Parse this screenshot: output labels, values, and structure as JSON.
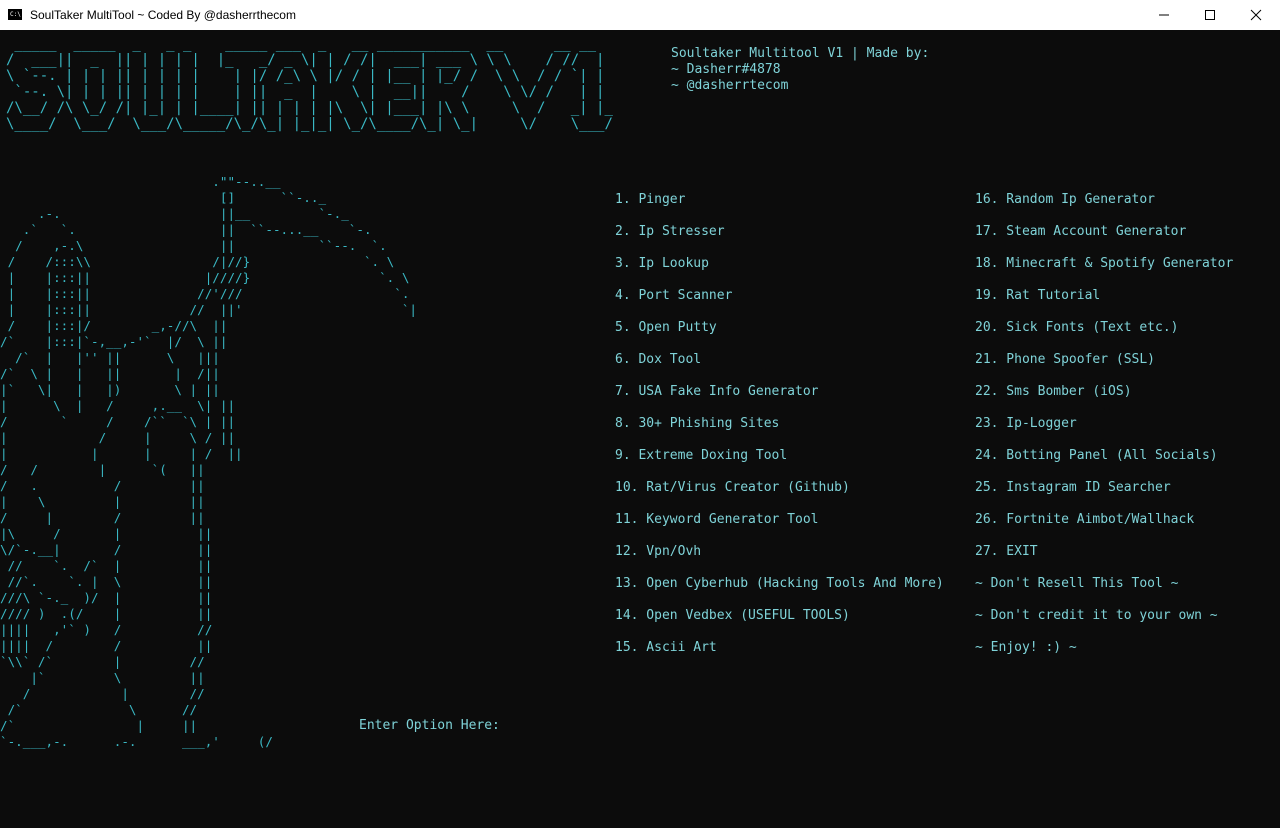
{
  "window": {
    "title": "SoulTaker MultiTool ~ Coded By @dasherrthecom",
    "icon": "cmd-icon",
    "controls": [
      "minimize-icon",
      "maximize-icon",
      "close-icon"
    ]
  },
  "console": {
    "banner": " _____  _____  _   _ _    _____ ___  _   __ ___________  __      __ __\n/  ___||  _  || | | | |  |_   _/ _ \\| | / /|  ___| ___ \\ \\ \\    / //  |\n\\ `--. | | | || | | | |    | |/ /_\\ \\ |/ / | |__ | |_/ /  \\ \\  / / `| |\n `--. \\| | | || | | | |    | ||  _  |    \\ |  __||    /    \\ \\/ /   | |\n/\\__/ /\\ \\_/ /| |_| | |____| || | | | |\\  \\| |___| |\\ \\     \\  /   _| |_\n\\____/  \\___/  \\___/\\_____/\\_/\\_| |_|_| \\_/\\____/\\_| \\_|     \\/    \\___/",
    "credit_lines": [
      "Soultaker Multitool V1 | Made by:",
      "~ Dasherr#4878",
      "~ @dasherrtecom"
    ],
    "reaper_art": "                            .\"\"--..__\n                             []      ``-.._\n     .-.                     ||__         `-._\n   .`   `.                   ||  ``--...__    `-.\n  /    ,-.\\                  ||           ``--.  `.\n /    /:::\\\\                /|//}               `. \\\n |    |:::||               |////}                 `. \\\n |    |:::||              //'///                    `.\n |    |:::||             //  ||'                     `|\n /    |:::|/        _,-//\\  ||\n/`    |:::|`-,__,-'`  |/  \\ ||\n  /`  |   |'' ||      \\   |||\n/`  \\ |   |   ||       |  /||\n|`   \\|   |   |)       \\ | ||\n|      \\  |   /     ,.__  \\| ||\n/       `     /    /``  `\\ | ||\n|            /     |     \\ / ||\n|           |      |     | /  ||\n/   /        |      `(   ||\n/   .          /         ||\n|    \\         |         ||\n/     |        /         ||\n|\\     /       |          ||\n\\/`-.__|       /          ||\n //    `.  /`  |          ||\n //`.    `. |  \\          ||\n///\\ `-._  )/  |          ||\n//// )  .(/    |          ||\n||||   ,'` )   /          //\n||||  /        /          ||\n`\\\\` /`        |         //\n    |`         \\         ||\n   /            |        //\n /`              \\      //\n/`                |     ||\n`-.___,-.      .-.      ___,'     (/",
    "prompt": "Enter Option Here:",
    "menu_left": [
      "1. Pinger",
      "2. Ip Stresser",
      "3. Ip Lookup",
      "4. Port Scanner",
      "5. Open Putty",
      "6. Dox Tool",
      "7. USA Fake Info Generator",
      "8. 30+ Phishing Sites",
      "9. Extreme Doxing Tool",
      "10. Rat/Virus Creator (Github)",
      "11. Keyword Generator Tool",
      "12. Vpn/Ovh",
      "13. Open Cyberhub (Hacking Tools And More)",
      "14. Open Vedbex (USEFUL TOOLS)",
      "15. Ascii Art"
    ],
    "menu_right": [
      "16. Random Ip Generator",
      "17. Steam Account Generator",
      "18. Minecraft & Spotify Generator",
      "19. Rat Tutorial",
      "20. Sick Fonts (Text etc.)",
      "21. Phone Spoofer (SSL)",
      "22. Sms Bomber (iOS)",
      "23. Ip-Logger",
      "24. Botting Panel (All Socials)",
      "25. Instagram ID Searcher",
      "26. Fortnite Aimbot/Wallhack",
      "27. EXIT",
      "~ Don't Resell This Tool ~",
      "~ Don't credit it to your own ~",
      "~ Enjoy! :) ~"
    ]
  },
  "colors": {
    "console_bg": "#0c0c0c",
    "text": "#7fd3d8",
    "art": "#3ab8c4"
  }
}
